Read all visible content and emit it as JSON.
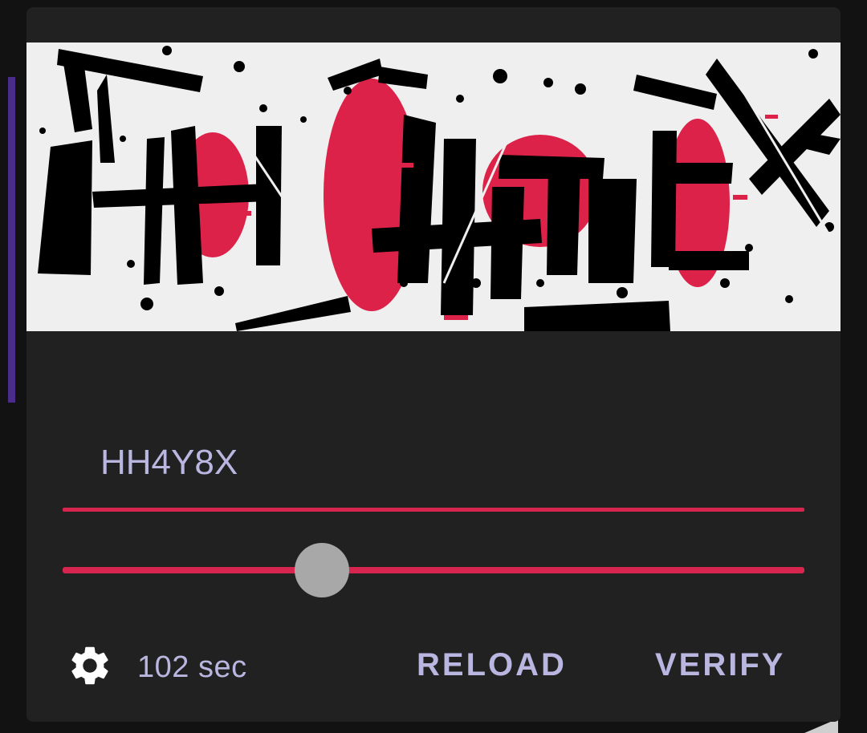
{
  "captcha": {
    "image_alt": "HH4Y8X"
  },
  "answer": {
    "value": "HH4Y8X"
  },
  "difficulty_slider": {
    "value": 0.35
  },
  "footer": {
    "settings_icon": "gear-icon",
    "timer": "102 sec",
    "reload_label": "RELOAD",
    "verify_label": "VERIFY"
  },
  "colors": {
    "accent": "#d6264f",
    "text": "#b9b6e0",
    "dialog_bg": "#212121",
    "page_bg": "#121212"
  }
}
